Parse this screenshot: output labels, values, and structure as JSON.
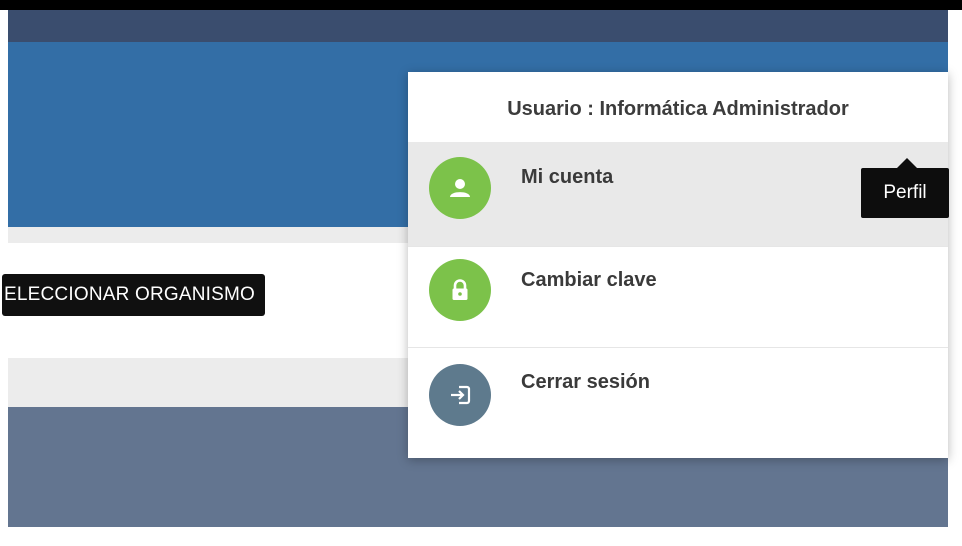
{
  "org_tooltip": {
    "text": "ELECCIONAR ORGANISMO"
  },
  "dropdown": {
    "title": "Usuario : Informática Administrador",
    "items": [
      {
        "label": "Mi cuenta",
        "icon": "user-icon",
        "color": "#7cc24a",
        "active": true
      },
      {
        "label": "Cambiar clave",
        "icon": "lock-icon",
        "color": "#7cc24a",
        "active": false
      },
      {
        "label": "Cerrar sesión",
        "icon": "logout-icon",
        "color": "#5e7a8d",
        "active": false
      }
    ]
  },
  "perfil_tooltip": {
    "text": "Perfil"
  },
  "colors": {
    "header_blue": "#336ea6",
    "top_strip": "#3a4d6e",
    "slate_panel": "#637590",
    "accent_green": "#7cc24a"
  }
}
